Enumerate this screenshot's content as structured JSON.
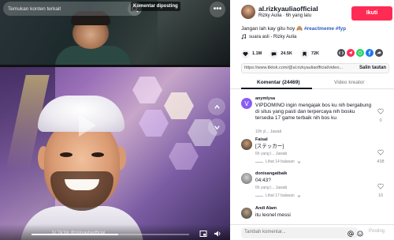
{
  "video": {
    "search_placeholder": "Temukan konten terkait",
    "pinned_label": "Komentar diposting",
    "more_label": "•••",
    "watermark": "SI TikTok @rizkyauliaofficial",
    "progress": 0.55
  },
  "author": {
    "username": "al.rizkyauliaofficial",
    "subtitle": "Rizky Aulia · 6h yang lalu",
    "follow_label": "Ikuti"
  },
  "post": {
    "caption_text": "Jangan lah kay gitu hoy 🙈",
    "caption_tags": "#reactmeme #fyp",
    "sound": "suara asli - Rizky Aulia"
  },
  "stats": {
    "likes": "1.1M",
    "comments": "24.5K",
    "bookmarks": "72K"
  },
  "share": {
    "link": "https://www.tiktok.com/@al.rizkyauliaofficial/video...",
    "copy_label": "Salin tautan"
  },
  "tabs": {
    "comments_label": "Komentar (24469)",
    "creator_label": "Video kreator"
  },
  "comments": [
    {
      "name": "anymlysa",
      "body": "VIPDOMINO ingin mengajak bos ku nih bergabung di situs yang pasti dan terpercaya nih bosku tersedia 17 game terbaik nih bos ku",
      "meta": "10h yl... Jawab",
      "likes": "0",
      "reply": ""
    },
    {
      "name": "Faisal",
      "body": "[ステッカー]",
      "meta": "6h yang l... Jawab",
      "likes": "438",
      "reply": "Lihat 14 balasan"
    },
    {
      "name": "donisangatbaik",
      "body": "04:43?",
      "meta": "6h yang l... Jawab",
      "likes": "10",
      "reply": "Lihat 17 balasan"
    },
    {
      "name": "Andi Alam",
      "body": "itu leonel messi",
      "meta": "",
      "likes": "",
      "reply": ""
    }
  ],
  "composer": {
    "placeholder": "Tambah komentar...",
    "post_label": "Posting"
  },
  "colors": {
    "brand": "#fe2c55",
    "tag": "#2b5db9"
  }
}
